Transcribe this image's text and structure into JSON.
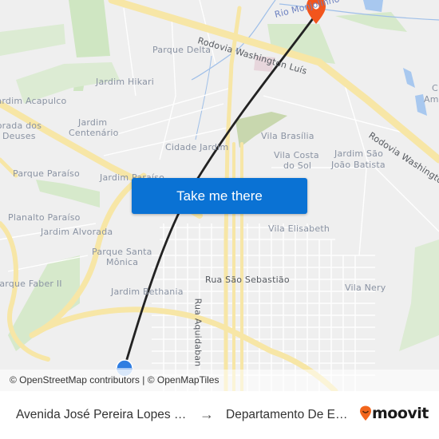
{
  "map": {
    "labels": {
      "parque_delta": "Parque Delta",
      "jardim_hikari": "Jardim Hikari",
      "jardim_acapulco": "Jardim Acapulco",
      "morada_dos_deuses_1": "Morada dos",
      "morada_dos_deuses_2": "Deuses",
      "jardim_centenario_1": "Jardim",
      "jardim_centenario_2": "Centenário",
      "cidade_jardim": "Cidade Jardim",
      "parque_paraiso": "Parque Paraíso",
      "jardim_paraiso": "Jardim Paraíso",
      "planalto_paraiso": "Planalto Paraíso",
      "jardim_alvorada": "Jardim Alvorada",
      "parque_santa_monica_1": "Parque Santa",
      "parque_santa_monica_2": "Mônica",
      "parque_faber": "Parque Faber II",
      "jardim_bethania": "Jardim Bethania",
      "vila_brasilia": "Vila Brasília",
      "vila_costa_do_sol_1": "Vila Costa",
      "vila_costa_do_sol_2": "do Sol",
      "jardim_sao_joao_1": "Jardim São",
      "jardim_sao_joao_2": "João Batista",
      "vila_elisabeth": "Vila Elisabeth",
      "vila_nery": "Vila Nery",
      "rua_sao_sebastiao": "Rua São Sebastião",
      "rua_aquidaban": "Rua Aquidaban",
      "rodovia_washington_1": "Rodovia Washington Luís",
      "rodovia_washington_2": "Rodovia Washington",
      "rio_monjolinho": "Rio Monjolinho",
      "edge_c": "C",
      "edge_am": "Am"
    },
    "attribution": "© OpenStreetMap contributors | © OpenMapTiles",
    "route_color": "#222222",
    "origin_color": "#2f7de1",
    "destination_color": "#f2551d"
  },
  "cta": {
    "label": "Take me there"
  },
  "footer": {
    "from": "Avenida José Pereira Lopes …",
    "arrow": "→",
    "to": "Departamento De E…",
    "brand": "moovit",
    "brand_color": "#f2661c"
  }
}
